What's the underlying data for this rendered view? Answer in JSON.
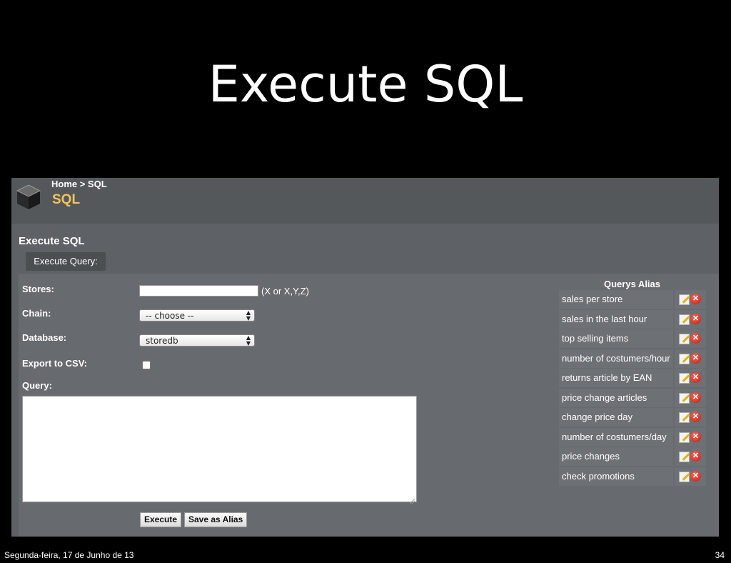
{
  "slide": {
    "title": "Execute SQL",
    "footer_date": "Segunda-feira, 17 de Junho de 13",
    "page_number": "34"
  },
  "header": {
    "breadcrumb": "Home > SQL",
    "page_title": "SQL"
  },
  "section": {
    "title": "Execute SQL",
    "tab_label": "Execute Query:"
  },
  "form": {
    "stores_label": "Stores:",
    "stores_value": "",
    "stores_hint": "(X or X,Y,Z)",
    "chain_label": "Chain:",
    "chain_value": "-- choose --",
    "database_label": "Database:",
    "database_value": "storedb",
    "export_label": "Export to CSV:",
    "export_checked": false,
    "query_label": "Query:",
    "query_value": "",
    "execute_label": "Execute",
    "save_alias_label": "Save as Alias"
  },
  "aliases": {
    "title": "Querys Alias",
    "items": [
      {
        "name": "sales per store"
      },
      {
        "name": "sales in the last hour"
      },
      {
        "name": "top selling items"
      },
      {
        "name": "number of costumers/hour"
      },
      {
        "name": "returns article by EAN"
      },
      {
        "name": "price change articles"
      },
      {
        "name": "change price day"
      },
      {
        "name": "number of costumers/day"
      },
      {
        "name": "price changes"
      },
      {
        "name": "check promotions"
      }
    ]
  },
  "colors": {
    "accent_title": "#f3c35e",
    "panel_bg": "#676b6f",
    "delete_red": "#c0170a"
  }
}
